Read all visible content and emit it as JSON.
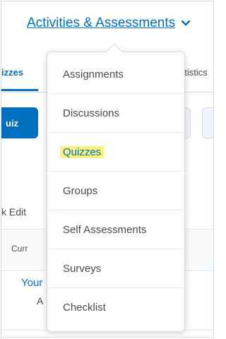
{
  "nav": {
    "title": "Activities & Assessments",
    "chevron_icon": "chevron-down-icon"
  },
  "background": {
    "tab_left_label": "izzes",
    "tab_right_label": "atistics",
    "primary_button_label": "uiz",
    "edit_text": "k Edit",
    "table_header": "Curr",
    "row_link": "Your",
    "row_value": "A"
  },
  "dropdown": {
    "items": [
      {
        "label": "Assignments"
      },
      {
        "label": "Discussions"
      },
      {
        "label": "Quizzes"
      },
      {
        "label": "Groups"
      },
      {
        "label": "Self Assessments"
      },
      {
        "label": "Surveys"
      },
      {
        "label": "Checklist"
      }
    ]
  },
  "colors": {
    "link": "#006fbf",
    "highlight": "#fbf27e",
    "text": "#494c4e"
  }
}
